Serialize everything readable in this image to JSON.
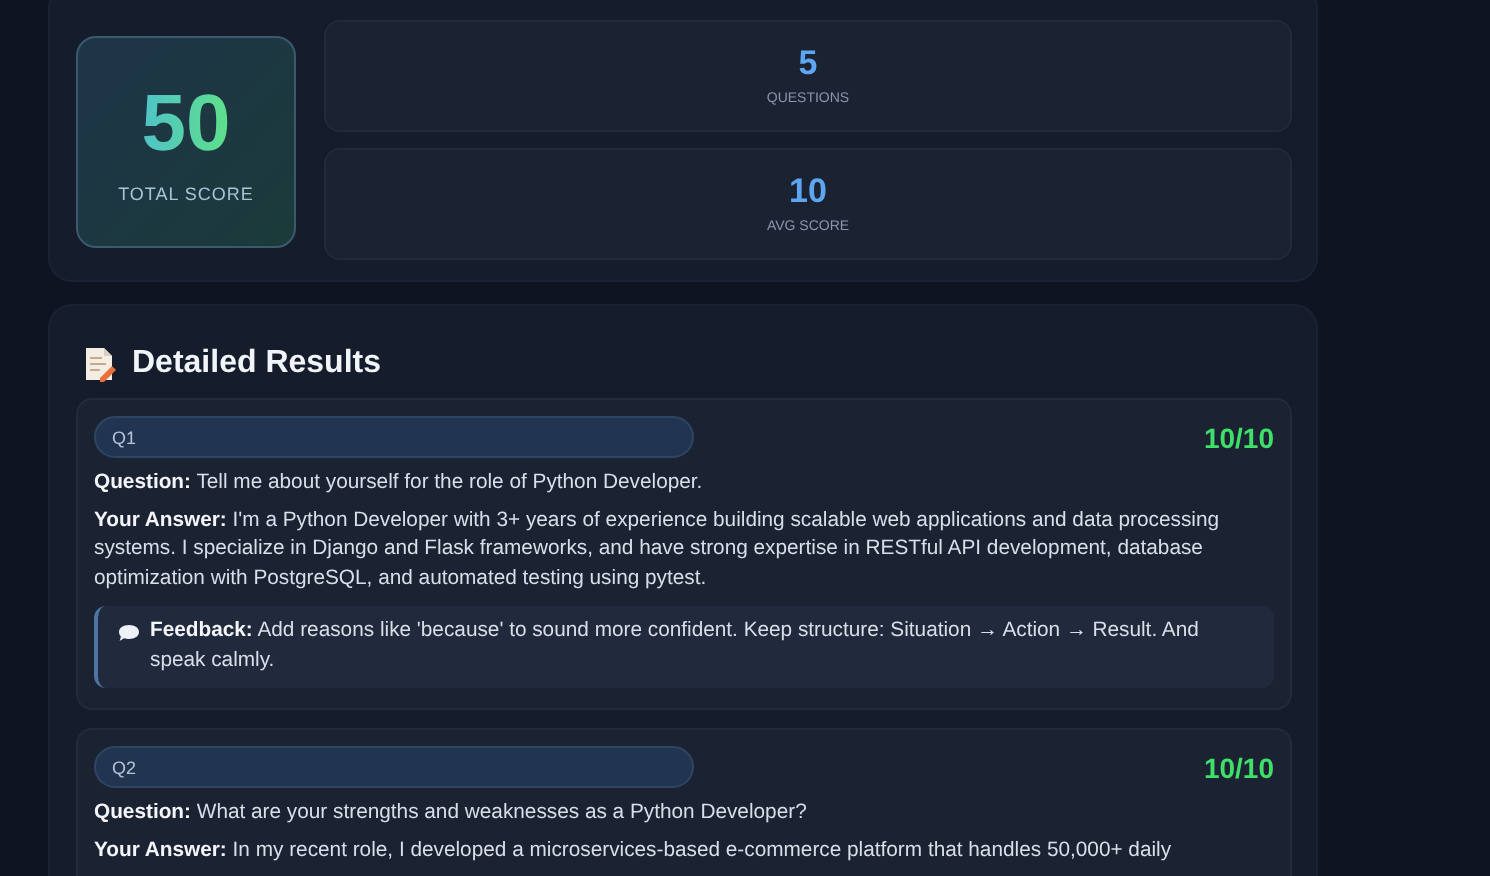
{
  "summary": {
    "total": {
      "value": "50",
      "label": "TOTAL SCORE"
    },
    "stats": [
      {
        "value": "5",
        "label": "QUESTIONS"
      },
      {
        "value": "10",
        "label": "AVG SCORE"
      }
    ]
  },
  "results": {
    "title": "Detailed Results",
    "items": [
      {
        "tag": "Q1",
        "score": "10/10",
        "question": "**Question:** Tell me about yourself for the role of Python Developer.",
        "answer": "**Your Answer:** I'm a Python Developer with 3+ years of experience building scalable web applications and data processing systems. I specialize in Django and Flask frameworks, and have strong expertise in RESTful API development, database optimization with PostgreSQL, and automated testing using pytest.",
        "feedback": "**Feedback:** Add reasons like 'because' to sound more confident. Keep structure: Situation → Action → Result. And speak calmly."
      },
      {
        "tag": "Q2",
        "score": "10/10",
        "question": "**Question:** What are your strengths and weaknesses as a Python Developer?",
        "answer": "**Your Answer:** In my recent role, I developed a microservices-based e-commerce platform that handles 50,000+ daily"
      }
    ]
  }
}
